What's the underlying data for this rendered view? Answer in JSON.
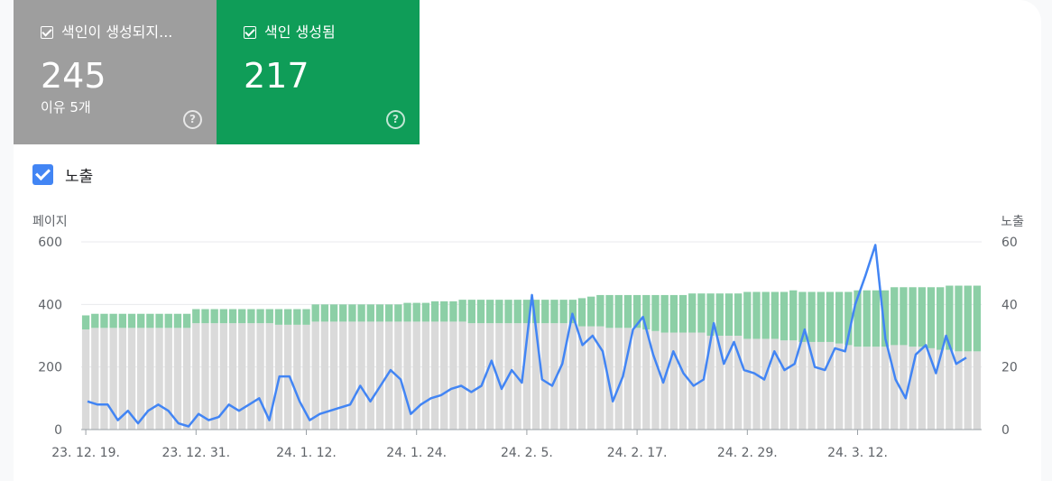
{
  "tiles": [
    {
      "label": "색인이 생성되지...",
      "value": "245",
      "sub": "이유 5개",
      "color": "#9e9e9e"
    },
    {
      "label": "색인 생성됨",
      "value": "217",
      "color": "#0f9d58"
    }
  ],
  "help_glyph": "?",
  "toggle": {
    "label": "노출",
    "checked": true,
    "color": "#4285f4"
  },
  "chart_data": {
    "type": "bar",
    "left_axis": {
      "label": "페이지",
      "ticks": [
        "0",
        "200",
        "400",
        "600"
      ],
      "range": [
        0,
        600
      ]
    },
    "right_axis": {
      "label": "노출",
      "ticks": [
        "0",
        "20",
        "40",
        "60"
      ],
      "range": [
        0,
        60
      ]
    },
    "x_tick_labels": [
      "23. 12. 19.",
      "23. 12. 31.",
      "24. 1. 12.",
      "24. 1. 24.",
      "24. 2. 5.",
      "24. 2. 17.",
      "24. 2. 29.",
      "24. 3. 12."
    ],
    "x_tick_index": [
      0,
      12,
      24,
      36,
      48,
      60,
      72,
      84
    ],
    "series": [
      {
        "type": "stacked-bar",
        "color": "#dadada",
        "values": [
          320,
          325,
          325,
          325,
          325,
          325,
          325,
          325,
          325,
          325,
          325,
          325,
          340,
          340,
          340,
          340,
          340,
          340,
          340,
          340,
          340,
          335,
          335,
          335,
          335,
          345,
          345,
          345,
          345,
          345,
          345,
          345,
          345,
          345,
          345,
          345,
          345,
          345,
          345,
          345,
          345,
          345,
          340,
          340,
          340,
          340,
          340,
          340,
          340,
          340,
          340,
          340,
          340,
          340,
          330,
          330,
          330,
          325,
          325,
          325,
          325,
          320,
          315,
          310,
          310,
          310,
          310,
          310,
          300,
          300,
          300,
          300,
          290,
          290,
          290,
          290,
          285,
          285,
          280,
          280,
          280,
          280,
          275,
          270,
          265,
          265,
          265,
          265,
          270,
          270,
          265,
          265,
          260,
          255,
          255,
          250,
          250,
          250
        ]
      },
      {
        "type": "stacked-bar",
        "color": "#8ccfa6",
        "values": [
          45,
          45,
          45,
          45,
          45,
          45,
          45,
          45,
          45,
          45,
          45,
          45,
          45,
          45,
          45,
          45,
          45,
          45,
          45,
          45,
          45,
          50,
          50,
          50,
          50,
          55,
          55,
          55,
          55,
          55,
          55,
          55,
          55,
          55,
          55,
          60,
          60,
          60,
          65,
          65,
          65,
          70,
          75,
          75,
          75,
          75,
          75,
          75,
          75,
          75,
          75,
          75,
          75,
          75,
          90,
          95,
          100,
          105,
          105,
          105,
          105,
          110,
          115,
          120,
          120,
          120,
          125,
          125,
          135,
          135,
          135,
          135,
          150,
          150,
          150,
          150,
          155,
          160,
          160,
          160,
          160,
          160,
          165,
          170,
          180,
          180,
          180,
          180,
          185,
          185,
          190,
          190,
          195,
          200,
          205,
          210,
          210,
          210
        ]
      },
      {
        "type": "line",
        "color": "#4285f4",
        "values": [
          9,
          8,
          8,
          3,
          6,
          2,
          6,
          8,
          6,
          2,
          1,
          5,
          3,
          4,
          8,
          6,
          8,
          10,
          3,
          17,
          17,
          9,
          3,
          5,
          6,
          7,
          8,
          14,
          9,
          14,
          19,
          16,
          5,
          8,
          10,
          11,
          13,
          14,
          12,
          14,
          22,
          13,
          19,
          15,
          43,
          16,
          14,
          21,
          37,
          27,
          30,
          25,
          9,
          17,
          32,
          36,
          24,
          15,
          25,
          18,
          14,
          16,
          34,
          21,
          28,
          19,
          18,
          16,
          25,
          19,
          21,
          32,
          20,
          19,
          26,
          25,
          40,
          49,
          59,
          29,
          16,
          10,
          24,
          27,
          18,
          30,
          21,
          23
        ]
      }
    ]
  }
}
